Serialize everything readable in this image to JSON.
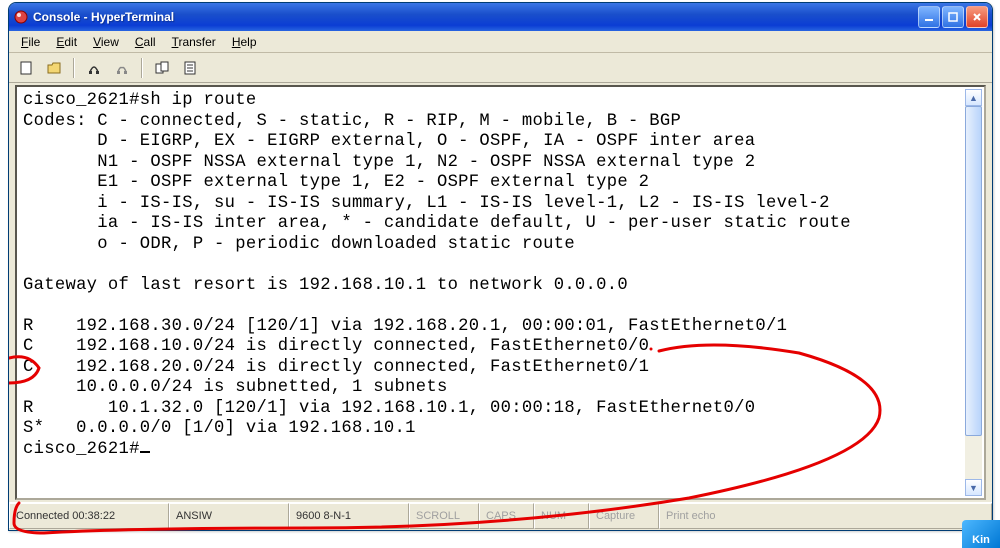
{
  "window": {
    "title": "Console - HyperTerminal"
  },
  "menu": {
    "file": "File",
    "edit": "Edit",
    "view": "View",
    "call": "Call",
    "transfer": "Transfer",
    "help": "Help"
  },
  "terminal": {
    "lines": [
      "cisco_2621#sh ip route",
      "Codes: C - connected, S - static, R - RIP, M - mobile, B - BGP",
      "       D - EIGRP, EX - EIGRP external, O - OSPF, IA - OSPF inter area",
      "       N1 - OSPF NSSA external type 1, N2 - OSPF NSSA external type 2",
      "       E1 - OSPF external type 1, E2 - OSPF external type 2",
      "       i - IS-IS, su - IS-IS summary, L1 - IS-IS level-1, L2 - IS-IS level-2",
      "       ia - IS-IS inter area, * - candidate default, U - per-user static route",
      "       o - ODR, P - periodic downloaded static route",
      "",
      "Gateway of last resort is 192.168.10.1 to network 0.0.0.0",
      "",
      "R    192.168.30.0/24 [120/1] via 192.168.20.1, 00:00:01, FastEthernet0/1",
      "C    192.168.10.0/24 is directly connected, FastEthernet0/0",
      "C    192.168.20.0/24 is directly connected, FastEthernet0/1",
      "     10.0.0.0/24 is subnetted, 1 subnets",
      "R       10.1.32.0 [120/1] via 192.168.10.1, 00:00:18, FastEthernet0/0",
      "S*   0.0.0.0/0 [1/0] via 192.168.10.1",
      "cisco_2621#"
    ]
  },
  "status": {
    "connected": "Connected 00:38:22",
    "detect": "ANSIW",
    "settings": "9600 8-N-1",
    "scroll": "SCROLL",
    "caps": "CAPS",
    "num": "NUM",
    "capture": "Capture",
    "printecho": "Print echo"
  },
  "kin": "Kin"
}
